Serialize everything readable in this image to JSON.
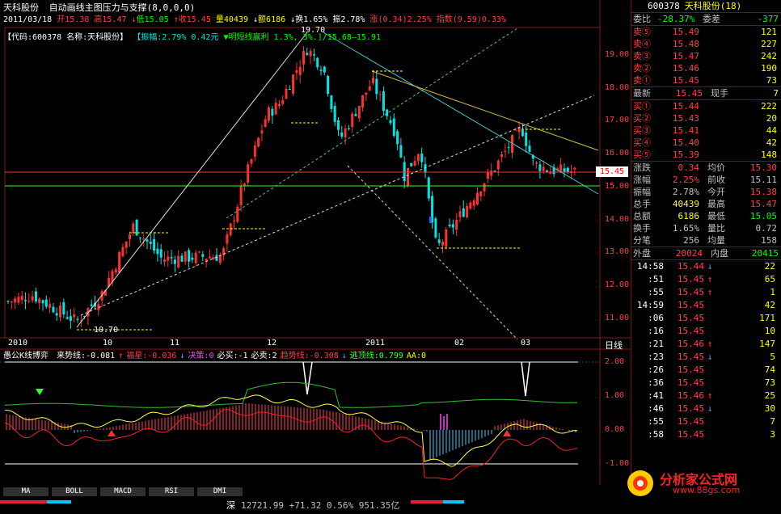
{
  "header": {
    "title": "天科股份",
    "indicator": "自动画线主图压力与支撑(8,0,0,0)",
    "date": "2011/03/18",
    "open": "开15.38",
    "high": "高15.47",
    "low": "低15.05",
    "close": "收15.45",
    "volume": "量40439",
    "amount": "额6186",
    "turnover": "换1.65%",
    "amplitude": "振2.78%",
    "change": "涨(0.34)2.25%",
    "index": "指数(9.59)0.33%"
  },
  "info_bar": {
    "code": "【代码:600378 名称:天科股份】",
    "amp": "【振幅:2.79% 0.42元",
    "trend": "▼明短线赢利",
    "range": "1.3%, 3%.]/15.68—15.91"
  },
  "price_labels": [
    "19.00",
    "18.00",
    "17.00",
    "16.00",
    "15.00",
    "14.00",
    "13.00",
    "12.00",
    "11.00"
  ],
  "current_price": "15.45",
  "annotations": {
    "high": "19.70",
    "low": "10.70"
  },
  "date_labels": [
    "2010",
    "10",
    "11",
    "12",
    "2011",
    "02",
    "03"
  ],
  "period": "日线",
  "indicator_bar": {
    "name": "愚公K线博弈",
    "items": [
      {
        "t": "来势线:-0.081",
        "c": "#ffffff"
      },
      {
        "t": "↑",
        "c": "#ff4040"
      },
      {
        "t": "福星:-0.036",
        "c": "#ff4040"
      },
      {
        "t": "↓",
        "c": "#4fa0ff"
      },
      {
        "t": "决策:0",
        "c": "#ff40ff"
      },
      {
        "t": "必买:-1",
        "c": "#ffffff"
      },
      {
        "t": "必卖:2",
        "c": "#ffffff"
      },
      {
        "t": "趋势线:-0.308",
        "c": "#ff4040"
      },
      {
        "t": "↓",
        "c": "#4fa0ff"
      },
      {
        "t": "逃顶线:0.799",
        "c": "#40ff40"
      },
      {
        "t": "AA:0",
        "c": "#ffff00"
      }
    ]
  },
  "sub_labels": [
    "2.00",
    "1.00",
    "0.00",
    "-1.00"
  ],
  "tabs": [
    "MA",
    "BOLL",
    "MACD",
    "RSI",
    "DMI"
  ],
  "bottom": {
    "market": "深",
    "text": "12721.99 +71.32 0.56% 951.35亿"
  },
  "panel": {
    "code": "600378",
    "name": "天科股份(18)",
    "webi": {
      "l": "委比",
      "v": "-28.37%",
      "l2": "委差",
      "v2": "-377"
    },
    "asks": [
      {
        "label": "卖⑤",
        "price": "15.49",
        "vol": "121"
      },
      {
        "label": "卖④",
        "price": "15.48",
        "vol": "227"
      },
      {
        "label": "卖③",
        "price": "15.47",
        "vol": "242"
      },
      {
        "label": "卖②",
        "price": "15.46",
        "vol": "190"
      },
      {
        "label": "卖①",
        "price": "15.45",
        "vol": "73"
      }
    ],
    "latest": {
      "l": "最新",
      "v": "15.45",
      "l2": "现手",
      "v2": "7"
    },
    "bids": [
      {
        "label": "买①",
        "price": "15.44",
        "vol": "222"
      },
      {
        "label": "买②",
        "price": "15.43",
        "vol": "20"
      },
      {
        "label": "买③",
        "price": "15.41",
        "vol": "44"
      },
      {
        "label": "买④",
        "price": "15.40",
        "vol": "42"
      },
      {
        "label": "买⑤",
        "price": "15.39",
        "vol": "148"
      }
    ],
    "stats": [
      {
        "l": "涨跌",
        "v": "0.34",
        "vc": "#ff4040",
        "l2": "均价",
        "v2": "15.30",
        "v2c": "#ff4040"
      },
      {
        "l": "涨幅",
        "v": "2.25%",
        "vc": "#ff4040",
        "l2": "前收",
        "v2": "15.11",
        "v2c": "#c0c0c0"
      },
      {
        "l": "振幅",
        "v": "2.78%",
        "vc": "#c0c0c0",
        "l2": "今开",
        "v2": "15.38",
        "v2c": "#ff4040"
      },
      {
        "l": "总手",
        "v": "40439",
        "vc": "#ffff00",
        "l2": "最高",
        "v2": "15.47",
        "v2c": "#ff4040"
      },
      {
        "l": "总额",
        "v": "6186",
        "vc": "#ffff00",
        "l2": "最低",
        "v2": "15.05",
        "v2c": "#00ff00"
      },
      {
        "l": "换手",
        "v": "1.65%",
        "vc": "#c0c0c0",
        "l2": "量比",
        "v2": "0.72",
        "v2c": "#c0c0c0"
      },
      {
        "l": "分笔",
        "v": "256",
        "vc": "#c0c0c0",
        "l2": "均量",
        "v2": "158",
        "v2c": "#c0c0c0"
      }
    ],
    "outer": {
      "l": "外盘",
      "v": "20024",
      "l2": "内盘",
      "v2": "20415"
    },
    "ticks": [
      {
        "t": "14:58",
        "p": "15.44",
        "a": "↓",
        "ac": "#4fa0ff",
        "v": "22"
      },
      {
        "t": ":51",
        "p": "15.45",
        "a": "↑",
        "ac": "#ff4040",
        "v": "65"
      },
      {
        "t": ":55",
        "p": "15.45",
        "a": "↑",
        "ac": "#ff4040",
        "v": "1"
      },
      {
        "t": "14:59",
        "p": "15.45",
        "a": "",
        "ac": "#fff",
        "v": "42"
      },
      {
        "t": ":06",
        "p": "15.45",
        "a": "",
        "ac": "#fff",
        "v": "171"
      },
      {
        "t": ":16",
        "p": "15.45",
        "a": "",
        "ac": "#fff",
        "v": "10"
      },
      {
        "t": ":21",
        "p": "15.46",
        "a": "↑",
        "ac": "#ff4040",
        "v": "147"
      },
      {
        "t": ":23",
        "p": "15.45",
        "a": "↓",
        "ac": "#4fa0ff",
        "v": "5"
      },
      {
        "t": ":26",
        "p": "15.45",
        "a": "",
        "ac": "#fff",
        "v": "74"
      },
      {
        "t": ":36",
        "p": "15.45",
        "a": "",
        "ac": "#fff",
        "v": "73"
      },
      {
        "t": ":41",
        "p": "15.46",
        "a": "↑",
        "ac": "#ff4040",
        "v": "25"
      },
      {
        "t": ":46",
        "p": "15.45",
        "a": "↓",
        "ac": "#4fa0ff",
        "v": "30"
      },
      {
        "t": ":55",
        "p": "15.45",
        "a": "",
        "ac": "#fff",
        "v": "7"
      },
      {
        "t": ":58",
        "p": "15.45",
        "a": "",
        "ac": "#fff",
        "v": "3"
      }
    ]
  },
  "watermark": {
    "cn": "分析家公式网",
    "url": "www.88gs.com"
  },
  "colors": {
    "up": "#ff3030",
    "down": "#00e6e6",
    "grid": "#7a1010"
  }
}
